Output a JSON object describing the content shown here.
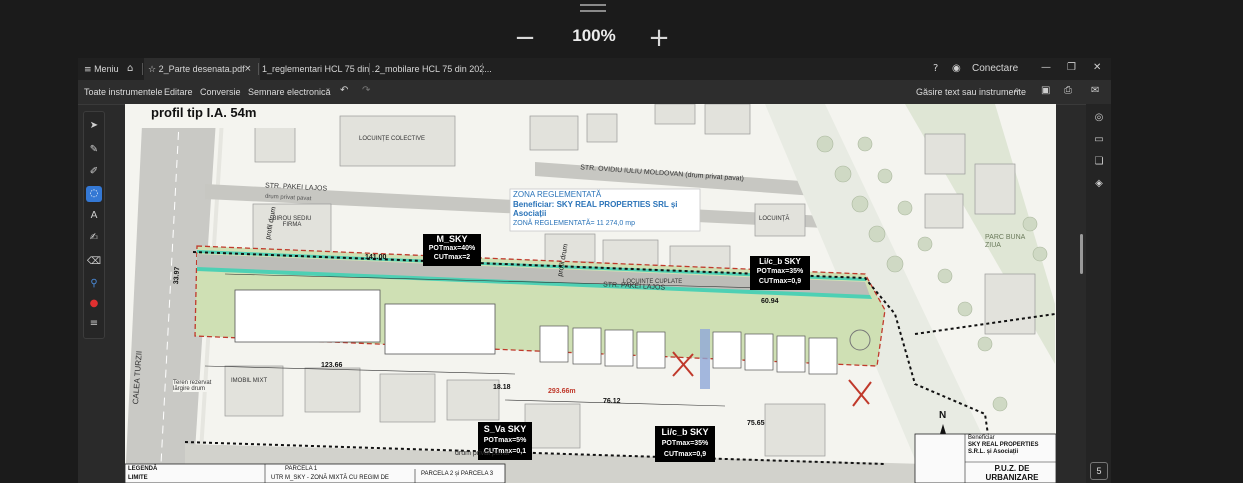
{
  "viewer": {
    "zoom": "100%"
  },
  "tabs": [
    {
      "label": "Meniu"
    },
    {
      "label": "2_Parte desenata.pdf",
      "active": true
    },
    {
      "label": "1_reglementari HCL 75 din ..."
    },
    {
      "label": "2_mobilare HCL 75 din 202..."
    }
  ],
  "account": {
    "connect_label": "Conectare"
  },
  "toolbar": {
    "items": [
      "Toate instrumentele",
      "Editare",
      "Conversie",
      "Semnare electronică"
    ],
    "search_label": "Găsire text sau instrumente"
  },
  "plan": {
    "profile_title": "profil tip I.A. 54m",
    "zona": {
      "title": "ZONA REGLEMENTATĂ",
      "beneficiar": "Beneficiar: SKY REAL PROPERTIES SRL și Asociații",
      "area": "ZONĂ REGLEMENTATĂ= 11 274,0 mp"
    },
    "zones": [
      {
        "name": "M_SKY",
        "pot": "POTmax=40%",
        "cut": "CUTmax=2"
      },
      {
        "name": "Li/c_b SKY",
        "pot": "POTmax=35%",
        "cut": "CUTmax=0,9"
      },
      {
        "name": "S_Va SKY",
        "pot": "POTmax=5%",
        "cut": "CUTmax=0,1"
      },
      {
        "name": "Li/c_b SKY",
        "pot": "POTmax=35%",
        "cut": "CUTmax=0,9"
      }
    ],
    "streets": {
      "calea": "CALEA TURZII",
      "pakei_1": "STR. PAKEI LAJOS",
      "pakei_2": "STR. PAKEI LAJOS",
      "moldovan": "STR. OVIDIU IULIU MOLDOVAN (drum privat pavat)",
      "drum_1": "drum privat pavat",
      "drum_2": "drum privat pavat",
      "profil_1": "profil drum",
      "profil_2": "profil drum"
    },
    "dims": [
      "141.00",
      "123.66",
      "76.12",
      "75.65",
      "60.94",
      "293.66m",
      "18.18",
      "33.97"
    ],
    "labels": {
      "locuinte_colective": "LOCUINȚE COLECTIVE",
      "locuinte_cuplate": "LOCUINȚE CUPLATE",
      "locuinta": "LOCUINȚĂ",
      "imobil_mixt": "IMOBIL MIXT",
      "birou": "BIROU SEDIU FIRMA",
      "parc": "PARC BUNA ZIUA",
      "teren": "Teren rezervat lărgire drum",
      "legenda": "LEGENDĂ",
      "limite": "LIMITE",
      "parcela_1": "PARCELA 1",
      "parcela_2": "PARCELA 2 și PARCELA 3",
      "ut": "UTR M_SKY - ZONĂ MIXTĂ CU REGIM DE",
      "north": "N",
      "title_block": {
        "beneficiar_label": "Beneficiar",
        "beneficiar": "SKY REAL PROPERTIES S.R.L. și Asociații",
        "proiect": "P.U.Z. DE URBANIZARE"
      }
    }
  },
  "page_indicator": "5"
}
